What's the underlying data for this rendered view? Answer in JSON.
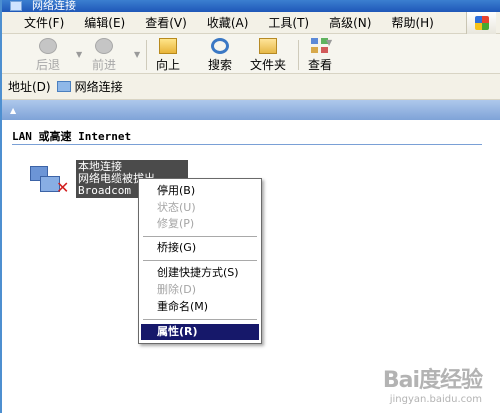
{
  "window": {
    "title": "网络连接"
  },
  "menubar": {
    "items": [
      {
        "label": "文件(F)"
      },
      {
        "label": "编辑(E)"
      },
      {
        "label": "查看(V)"
      },
      {
        "label": "收藏(A)"
      },
      {
        "label": "工具(T)"
      },
      {
        "label": "高级(N)"
      },
      {
        "label": "帮助(H)"
      }
    ]
  },
  "toolbar": {
    "back": "后退",
    "forward": "前进",
    "up": "向上",
    "search": "搜索",
    "folders": "文件夹",
    "views": "查看"
  },
  "address": {
    "label": "地址(D)",
    "value": "网络连接"
  },
  "content": {
    "group_title": "LAN 或高速 Internet",
    "connection": {
      "name": "本地连接",
      "status": "网络电缆被拔出",
      "adapter": "Broadcom Ne"
    }
  },
  "context_menu": {
    "items": [
      {
        "label": "停用(B)",
        "enabled": true
      },
      {
        "label": "状态(U)",
        "enabled": false
      },
      {
        "label": "修复(P)",
        "enabled": false
      },
      {
        "label": "桥接(G)",
        "enabled": true
      },
      {
        "label": "创建快捷方式(S)",
        "enabled": true
      },
      {
        "label": "删除(D)",
        "enabled": false
      },
      {
        "label": "重命名(M)",
        "enabled": true
      },
      {
        "label": "属性(R)",
        "enabled": true,
        "selected": true
      }
    ]
  },
  "watermark": {
    "logo": "Bai度经验",
    "url": "jingyan.baidu.com"
  }
}
